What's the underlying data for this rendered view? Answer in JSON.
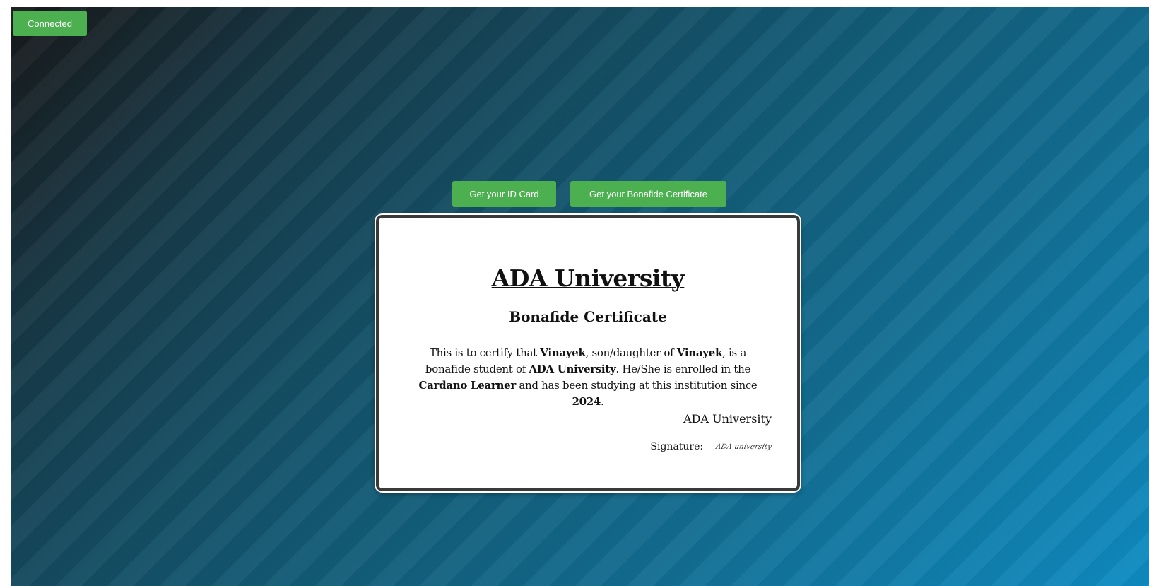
{
  "header": {
    "connected_label": "Connected"
  },
  "actions": {
    "id_card_label": "Get your ID Card",
    "bonafide_label": "Get your Bonafide Certificate"
  },
  "certificate": {
    "university": "ADA University",
    "title": "Bonafide Certificate",
    "body": {
      "p1": "This is to certify that ",
      "student_name": "Vinayek",
      "p2": ", son/daughter of ",
      "parent_name": "Vinayek",
      "p3": ", is a bonafide student of ",
      "institution": "ADA University",
      "p4": ". He/She is enrolled in the ",
      "course": "Cardano Learner",
      "p5": " and has been studying at this institution since ",
      "year": "2024",
      "p6": "."
    },
    "issuer": "ADA University",
    "signature_label": "Signature:",
    "signature_text": "ADA university"
  },
  "colors": {
    "button_green": "#4caf50",
    "bg_dark": "#18191b",
    "bg_light": "#0f8cc2"
  }
}
